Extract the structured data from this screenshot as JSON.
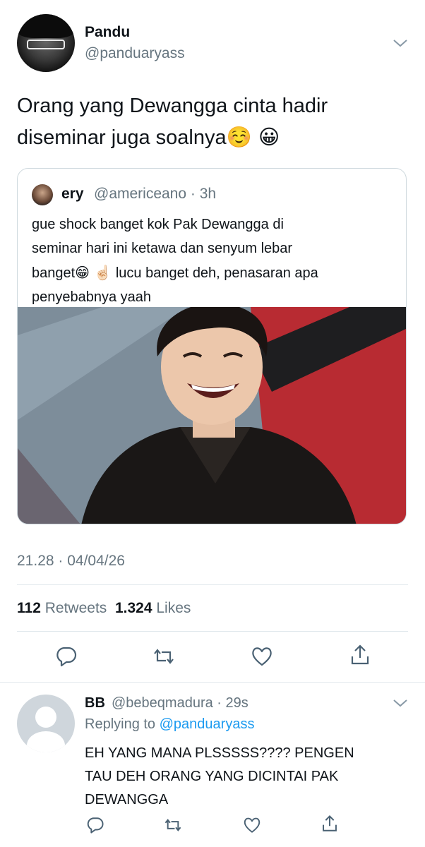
{
  "main_tweet": {
    "author_name": "Pandu",
    "author_handle": "@panduaryass",
    "text_line1": "Orang yang Dewangga cinta hadir",
    "text_line2": "diseminar juga soalnya",
    "emojis": "☺️ 😀",
    "timestamp": "21.28 · 04/04/26",
    "retweets_count": "112",
    "retweets_label": "Retweets",
    "likes_count": "1.324",
    "likes_label": "Likes"
  },
  "quote_tweet": {
    "author_name": "ery",
    "author_handle": "@americeano",
    "time": "· 3h",
    "line1": "gue shock banget kok Pak Dewangga di",
    "line2": "seminar hari ini ketawa dan senyum lebar",
    "line3_start": "banget",
    "line3_emoji": "😁 ☝🏻",
    "line3_end": " lucu banget deh, penasaran apa",
    "line4": "penyebabnya yaah"
  },
  "reply": {
    "author_name": "BB",
    "author_handle": "@bebeqmadura",
    "time": "· 29s",
    "replying_prefix": "Replying to",
    "replying_handle": "@panduaryass",
    "line1": "EH YANG MANA PLSSSSS???? PENGEN",
    "line2": "TAU DEH ORANG YANG DICINTAI PAK",
    "line3": "DEWANGGA"
  },
  "icons": [
    "chevron-down-icon",
    "reply-icon",
    "retweet-icon",
    "like-icon",
    "share-icon"
  ],
  "colors": {
    "text": "#0f1419",
    "muted": "#66757f",
    "link": "#1d9bf0",
    "divider": "#e1e8ed"
  }
}
